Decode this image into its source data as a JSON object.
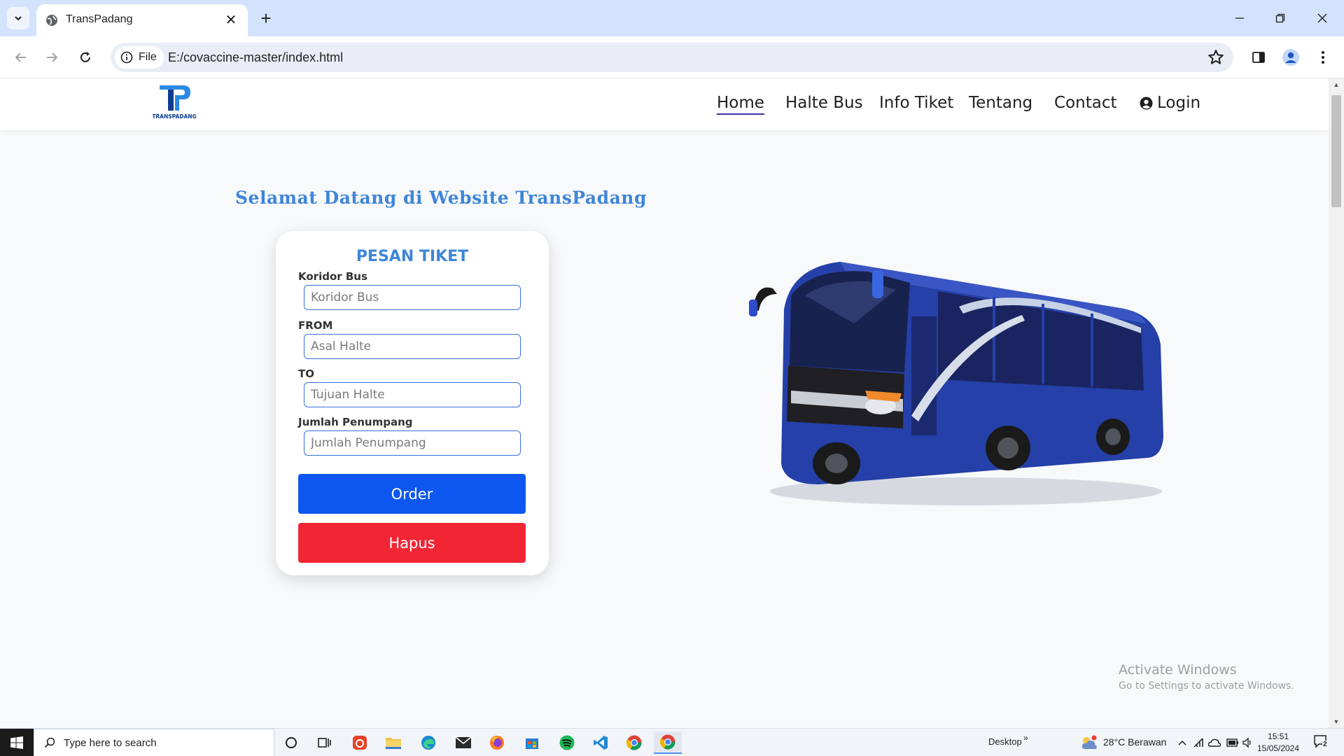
{
  "browser": {
    "tab_title": "TransPadang",
    "site_chip_label": "File",
    "url": "E:/covaccine-master/index.html"
  },
  "site": {
    "logo_text": "TRANSPADANG",
    "nav": [
      "Home",
      "Halte Bus",
      "Info Tiket",
      "Tentang",
      "Contact"
    ],
    "login_label": "Login",
    "welcome": "Selamat Datang di Website TransPadang"
  },
  "form": {
    "title": "PESAN TIKET",
    "fields": [
      {
        "label": "Koridor Bus",
        "placeholder": "Koridor Bus",
        "value": ""
      },
      {
        "label": "FROM",
        "placeholder": "Asal Halte",
        "value": ""
      },
      {
        "label": "TO",
        "placeholder": "Tujuan Halte",
        "value": ""
      },
      {
        "label": "Jumlah Penumpang",
        "placeholder": "Jumlah Penumpang",
        "value": ""
      }
    ],
    "order_label": "Order",
    "hapus_label": "Hapus"
  },
  "watermark": {
    "line1": "Activate Windows",
    "line2": "Go to Settings to activate Windows."
  },
  "taskbar": {
    "search_placeholder": "Type here to search",
    "desktop_label": "Desktop",
    "weather": "28°C  Berawan",
    "time": "15:51",
    "date": "15/05/2024",
    "notification_count": "2"
  },
  "colors": {
    "accent_blue": "#3e86d8",
    "order_button": "#0d57f0",
    "hapus_button": "#f22535",
    "nav_underline": "#3b34a8"
  }
}
